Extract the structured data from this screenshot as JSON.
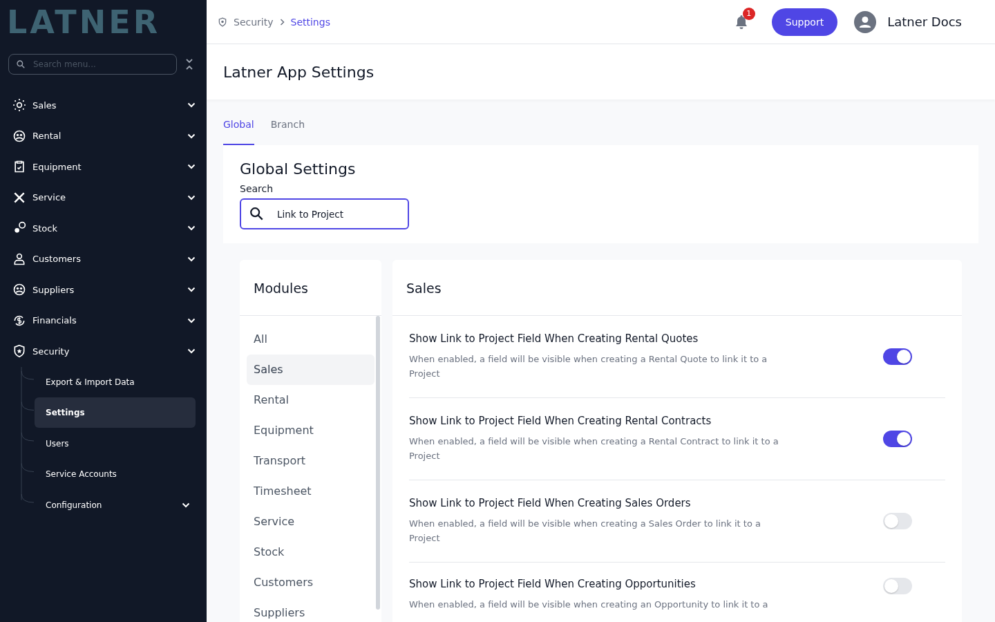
{
  "sidebar": {
    "logo": "LATNER",
    "search": {
      "placeholder": "Search menu..."
    },
    "items": [
      {
        "label": "Sales"
      },
      {
        "label": "Rental"
      },
      {
        "label": "Equipment"
      },
      {
        "label": "Service"
      },
      {
        "label": "Stock"
      },
      {
        "label": "Customers"
      },
      {
        "label": "Suppliers"
      },
      {
        "label": "Financials"
      },
      {
        "label": "Security",
        "children": [
          {
            "label": "Export & Import Data",
            "selected": false
          },
          {
            "label": "Settings",
            "selected": true
          },
          {
            "label": "Users",
            "selected": false
          },
          {
            "label": "Service Accounts",
            "selected": false
          },
          {
            "label": "Configuration",
            "selected": false,
            "has_submenu": true
          }
        ]
      }
    ]
  },
  "header": {
    "breadcrumb": [
      "Security",
      "Settings"
    ],
    "notifications": "1",
    "support_button": "Support",
    "user": "Latner Docs"
  },
  "page_title": "Latner App Settings",
  "tabs": [
    {
      "label": "Global",
      "selected": true
    },
    {
      "label": "Branch",
      "selected": false
    }
  ],
  "global_settings": {
    "title": "Global Settings",
    "search": {
      "label": "Search",
      "value": "Link to Project"
    }
  },
  "modules": {
    "title": "Modules",
    "items": [
      {
        "label": "All",
        "selected": false
      },
      {
        "label": "Sales",
        "selected": true
      },
      {
        "label": "Rental",
        "selected": false
      },
      {
        "label": "Equipment",
        "selected": false
      },
      {
        "label": "Transport",
        "selected": false
      },
      {
        "label": "Timesheet",
        "selected": false
      },
      {
        "label": "Service",
        "selected": false
      },
      {
        "label": "Stock",
        "selected": false
      },
      {
        "label": "Customers",
        "selected": false
      },
      {
        "label": "Suppliers",
        "selected": false
      }
    ]
  },
  "section": {
    "title": "Sales",
    "settings": [
      {
        "title": "Show Link to Project Field When Creating Rental Quotes",
        "description": "When enabled, a field will be visible when creating a Rental Quote to link it to a Project",
        "on": true
      },
      {
        "title": "Show Link to Project Field When Creating Rental Contracts",
        "description": "When enabled, a field will be visible when creating a Rental Contract to link it to a Project",
        "on": true
      },
      {
        "title": "Show Link to Project Field When Creating Sales Orders",
        "description": "When enabled, a field will be visible when creating a Sales Order to link it to a Project",
        "on": false
      },
      {
        "title": "Show Link to Project Field When Creating Opportunities",
        "description": "When enabled, a field will be visible when creating an Opportunity to link it to a",
        "on": false
      }
    ]
  }
}
